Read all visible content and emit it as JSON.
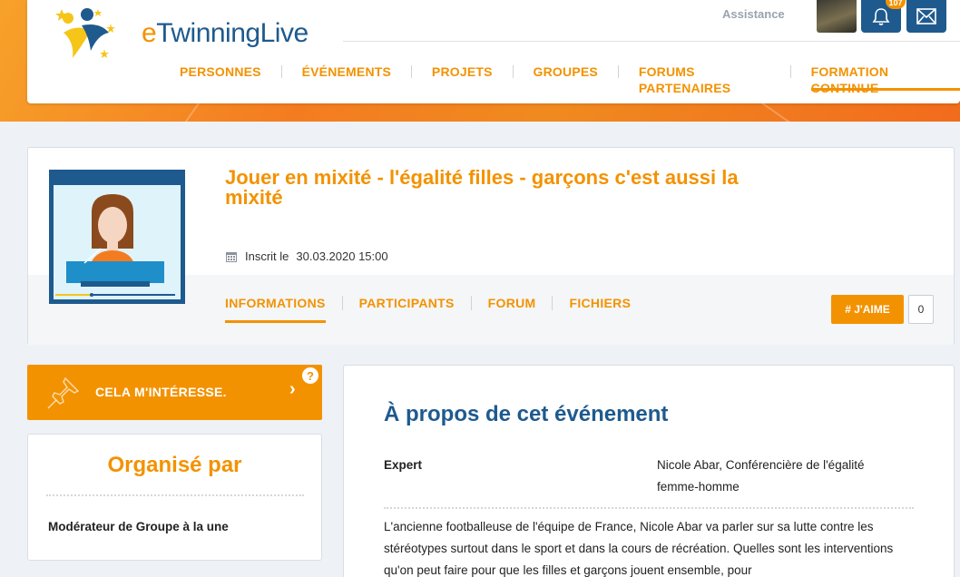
{
  "brand": {
    "logo_e": "e",
    "logo_twinning": "Twinning",
    "logo_live": "Live",
    "orange": "#f39200",
    "blue": "#1e5a8e"
  },
  "header": {
    "assistance": "Assistance",
    "notification_count": "107",
    "icons": [
      "bell-icon",
      "mail-icon"
    ]
  },
  "nav": {
    "items": [
      {
        "label": "PERSONNES",
        "active": false
      },
      {
        "label": "ÉVÉNEMENTS",
        "active": false
      },
      {
        "label": "PROJETS",
        "active": false
      },
      {
        "label": "GROUPES",
        "active": false
      },
      {
        "label": "FORUMS PARTENAIRES",
        "active": false
      },
      {
        "label": "FORMATION CONTINUE",
        "active": true
      }
    ]
  },
  "event": {
    "title": "Jouer en mixité - l'égalité filles - garçons c'est aussi la mixité",
    "registered_label": "Inscrit le",
    "registered_date": "30.03.2020 15:00",
    "tabs": [
      {
        "label": "INFORMATIONS",
        "active": true
      },
      {
        "label": "PARTICIPANTS",
        "active": false
      },
      {
        "label": "FORUM",
        "active": false
      },
      {
        "label": "FICHIERS",
        "active": false
      }
    ],
    "like_label": "# J'AIME",
    "like_count": "0"
  },
  "sidebar": {
    "interest_label": "CELA M'INTÉRESSE.",
    "help": "?",
    "organised_title": "Organisé par",
    "organiser": "Modérateur de Groupe à la une"
  },
  "about": {
    "title": "À propos de cet événement",
    "expert_label": "Expert",
    "expert_value": "Nicole Abar, Conférencière de l'égalité femme-homme",
    "description": "L'ancienne footballeuse de l'équipe de France, Nicole Abar va parler sur sa lutte contre les stéréotypes surtout dans le sport et dans la cours de récréation. Quelles sont les interventions qu'on peut faire pour que les filles et garçons jouent ensemble, pour"
  }
}
